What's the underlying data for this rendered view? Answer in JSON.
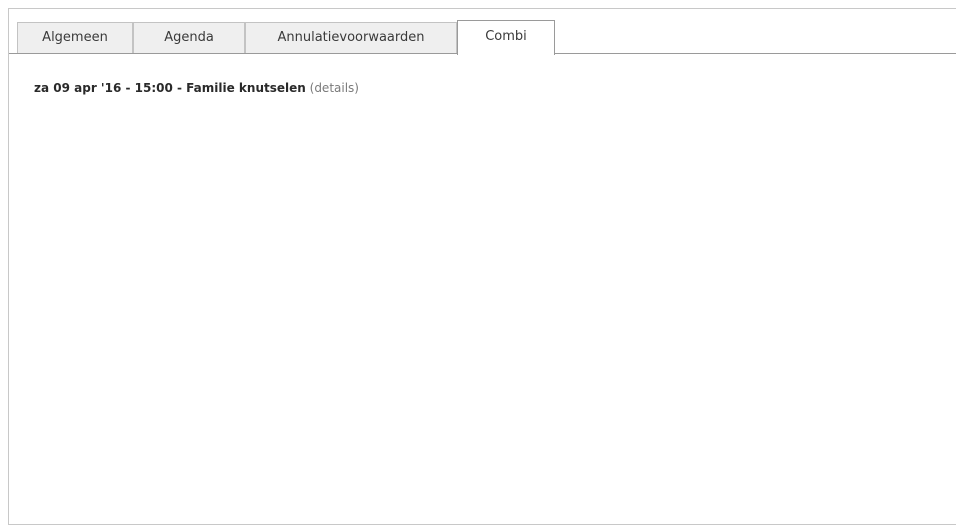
{
  "tabs": [
    {
      "label": "Algemeen",
      "active": false
    },
    {
      "label": "Agenda",
      "active": false
    },
    {
      "label": "Annulatievoorwaarden",
      "active": false
    },
    {
      "label": "Combi",
      "active": true
    }
  ],
  "event": {
    "text": "za 09 apr '16 - 15:00 - Familie knutselen",
    "open_paren": "(",
    "details_label": "details",
    "close_paren": ")"
  },
  "colors": {
    "border": "#c8c8c8",
    "tab_inactive_bg": "#efefef",
    "tab_active_bg": "#ffffff",
    "details_link": "#7a7a7a"
  }
}
